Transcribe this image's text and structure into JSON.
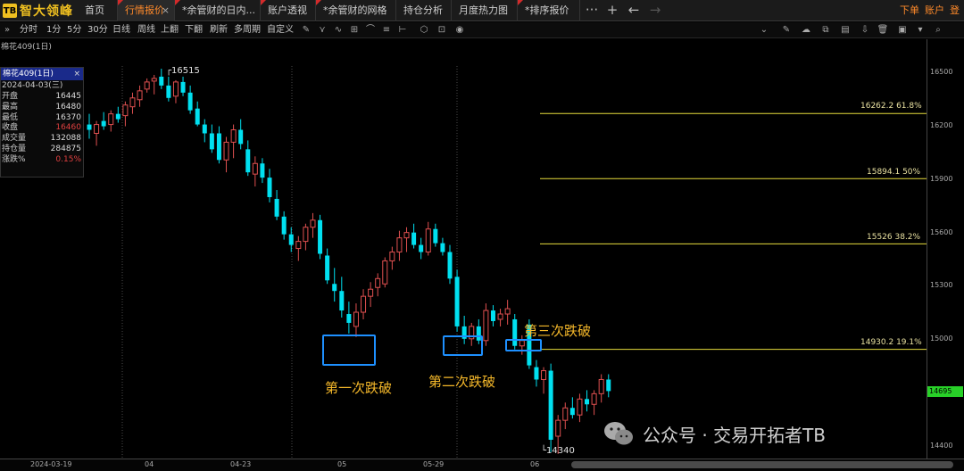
{
  "app": {
    "logo_mark": "TB",
    "name": "智大领峰"
  },
  "tabs": [
    {
      "label": "首页",
      "active": false
    },
    {
      "label": "行情报价",
      "active": true
    },
    {
      "label": "*余管财的日内...",
      "active": false
    },
    {
      "label": "账户透视",
      "active": false
    },
    {
      "label": "*余管财的网格",
      "active": false
    },
    {
      "label": "持仓分析",
      "active": false
    },
    {
      "label": "月度热力图",
      "active": false
    },
    {
      "label": "*排序报价",
      "active": false
    }
  ],
  "topbar_controls": {
    "more": "···",
    "add": "+",
    "back": "←",
    "forward": "→"
  },
  "top_right": {
    "order": "下单",
    "account": "账户",
    "login": "登录"
  },
  "toolbar": {
    "expand": "»",
    "periods": [
      "分时",
      "1分",
      "5分",
      "30分",
      "日线",
      "周线",
      "上翻",
      "下翻",
      "刷新",
      "多周期",
      "自定义"
    ]
  },
  "chart": {
    "title": "棉花409(1日)",
    "info": {
      "header": "棉花409(1日)",
      "date": "2024-04-03(三)",
      "rows": [
        {
          "label": "开盘",
          "value": "16445",
          "red": false
        },
        {
          "label": "最高",
          "value": "16480",
          "red": false
        },
        {
          "label": "最低",
          "value": "16370",
          "red": false
        },
        {
          "label": "收盘",
          "value": "16460",
          "red": true
        },
        {
          "label": "成交量",
          "value": "132088",
          "red": false
        },
        {
          "label": "持仓量",
          "value": "284875",
          "red": false
        },
        {
          "label": "涨跌%",
          "value": "0.15%",
          "red": true
        }
      ]
    },
    "price_axis": [
      "16500",
      "16200",
      "15900",
      "15600",
      "15300",
      "15000",
      "14695",
      "14400"
    ],
    "current_price": "14695",
    "date_axis": [
      "2024-03-19",
      "04",
      "04-23",
      "05",
      "05-29",
      "06"
    ],
    "high_label": "16515",
    "low_label": "14340",
    "fib_levels": [
      {
        "label": "16262.2 61.8%"
      },
      {
        "label": "15894.1 50%"
      },
      {
        "label": "15526 38.2%"
      },
      {
        "label": "14930.2 19.1%"
      }
    ],
    "annotations": [
      "第一次跌破",
      "第二次跌破",
      "第三次跌破"
    ],
    "colors": {
      "up": "#e05050",
      "down": "#00e0f0",
      "fib": "#e6dc3c",
      "box": "#1e90ff",
      "annot": "#f5b82a"
    }
  },
  "watermark": {
    "text": "公众号 · 交易开拓者TB"
  }
}
